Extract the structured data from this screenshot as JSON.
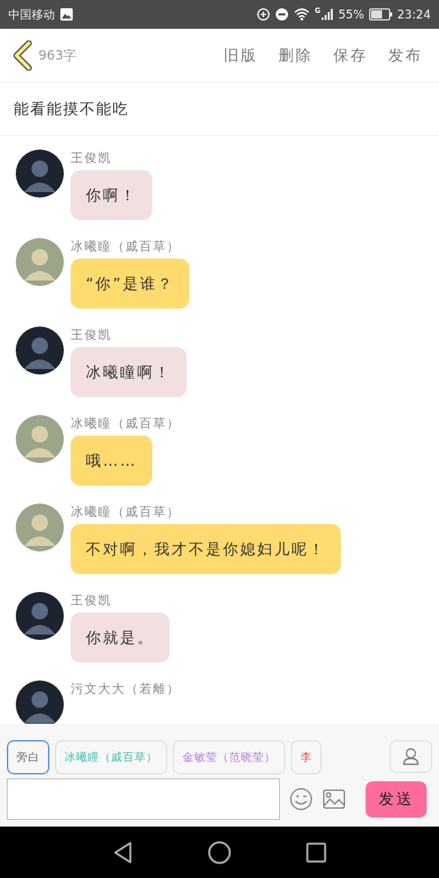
{
  "status_bar": {
    "carrier": "中国移动",
    "battery": "55%",
    "time": "23:24",
    "network": "G"
  },
  "header": {
    "word_count": "963字",
    "actions": [
      "旧版",
      "删除",
      "保存",
      "发布"
    ]
  },
  "title": "能看能摸不能吃",
  "messages": [
    {
      "name": "王俊凯",
      "text": "你啊！",
      "kind": "pink"
    },
    {
      "name": "冰曦瞳（戚百草）",
      "text": "“你”是谁？",
      "kind": "yellow"
    },
    {
      "name": "王俊凯",
      "text": "冰曦瞳啊！",
      "kind": "pink"
    },
    {
      "name": "冰曦瞳（戚百草）",
      "text": "哦……",
      "kind": "yellow"
    },
    {
      "name": "冰曦瞳（戚百草）",
      "text": "不对啊，我才不是你媳妇儿呢！",
      "kind": "yellow"
    },
    {
      "name": "王俊凯",
      "text": "你就是。",
      "kind": "pink"
    },
    {
      "name": "污文大大（若離）",
      "kind": "pink"
    }
  ],
  "roles": [
    {
      "label": "旁白",
      "color": "#666666",
      "selected": true
    },
    {
      "label": "冰曦瞳（戚百草）",
      "color": "#3cbfae",
      "selected": false
    },
    {
      "label": "金敏莹（范晓莹）",
      "color": "#b57be0",
      "selected": false
    },
    {
      "label": "李",
      "color": "#e0584f",
      "selected": false
    }
  ],
  "composer": {
    "send": "发送"
  }
}
